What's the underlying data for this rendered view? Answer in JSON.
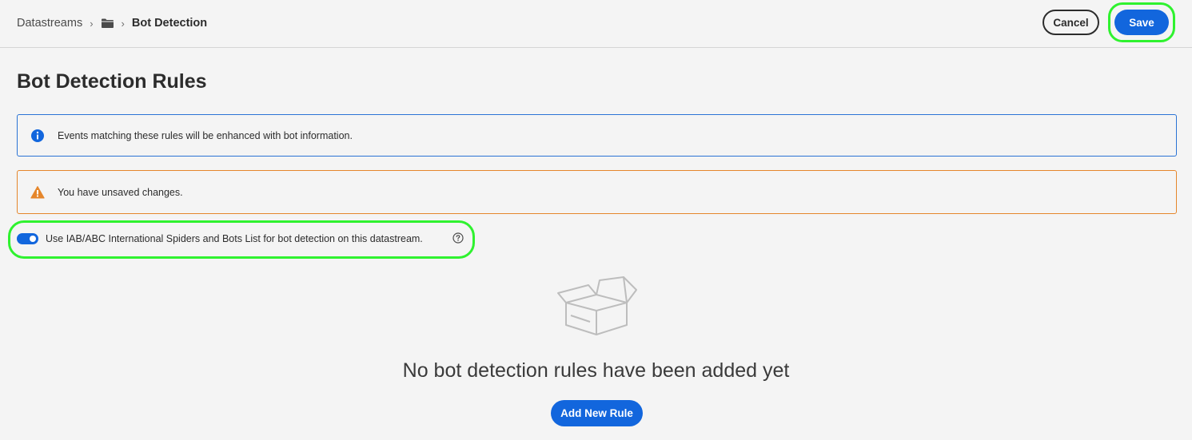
{
  "header": {
    "breadcrumb": {
      "root_label": "Datastreams",
      "folder_icon": "folder-icon",
      "current_label": "Bot Detection"
    },
    "cancel_label": "Cancel",
    "save_label": "Save"
  },
  "main": {
    "title": "Bot Detection Rules",
    "info_alert": {
      "icon": "info-icon",
      "text": "Events matching these rules will be enhanced with bot information."
    },
    "warning_alert": {
      "icon": "warning-icon",
      "text": "You have unsaved changes."
    },
    "iab_toggle": {
      "checked": true,
      "label": "Use IAB/ABC International Spiders and Bots List for bot detection on this datastream.",
      "help_icon": "help-icon"
    },
    "empty_state": {
      "illustration": "empty-box-illustration",
      "message": "No bot detection rules have been added yet",
      "add_button_label": "Add New Rule"
    }
  },
  "colors": {
    "accent": "#1266dd",
    "info_border": "#2a73d5",
    "warning": "#e5862b",
    "highlight": "#2ff22f",
    "background": "#f4f4f4"
  }
}
